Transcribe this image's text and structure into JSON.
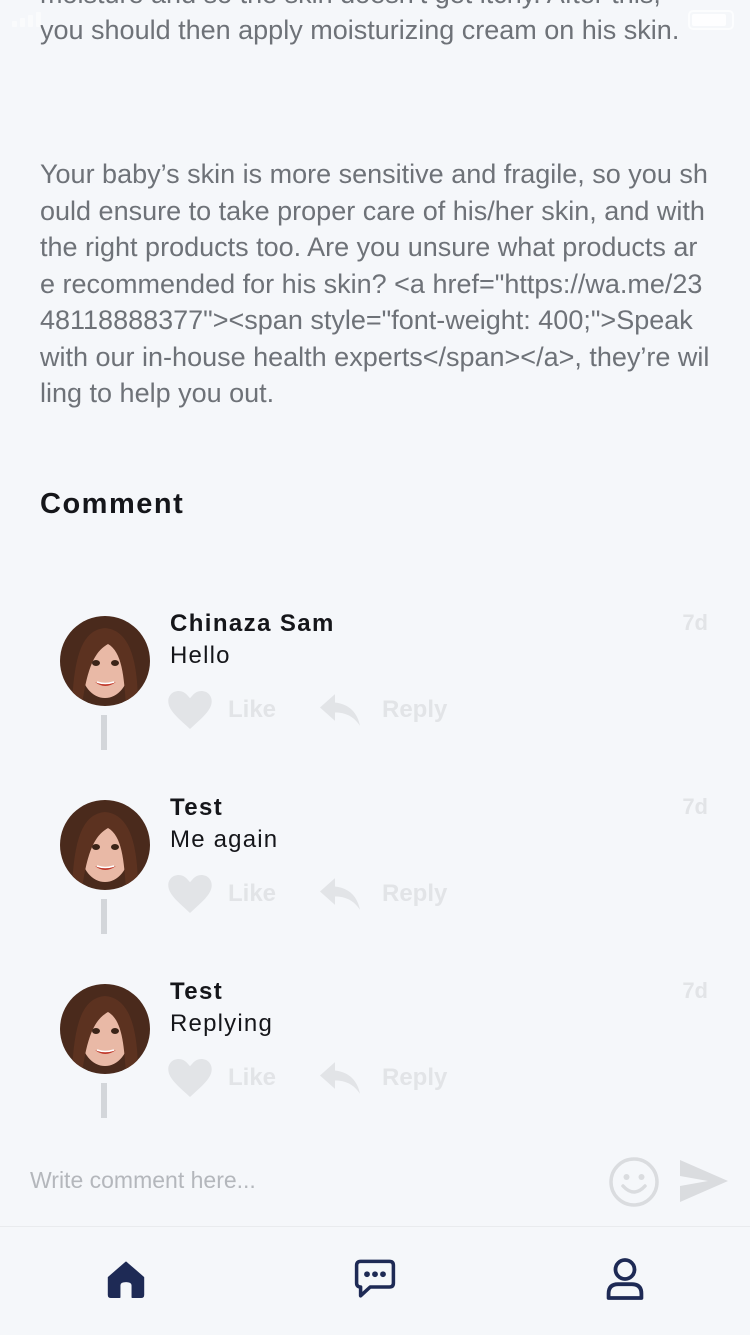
{
  "article": {
    "cut_text": "moisture and so the skin doesn’t get itchy. After this, you should then apply moisturizing cream on his skin.",
    "paragraph": "Your baby’s skin is more sensitive and fragile, so you should ensure to take proper care of his/her skin, and with the right products too. Are you unsure what products are recommended for his skin? <a href=\"https://wa.me/2348118888377\"><span style=\"font-weight: 400;\">Speak with our in-house health experts</span></a>, they’re willing to help you out."
  },
  "comments_section": {
    "heading": "Comment",
    "comments": [
      {
        "name": "Chinaza Sam",
        "text": "Hello",
        "time": "7d",
        "like_label": "Like",
        "reply_label": "Reply"
      },
      {
        "name": "Test",
        "text": "Me again",
        "time": "7d",
        "like_label": "Like",
        "reply_label": "Reply"
      },
      {
        "name": "Test",
        "text": "Replying",
        "time": "7d",
        "like_label": "Like",
        "reply_label": "Reply"
      }
    ]
  },
  "composer": {
    "placeholder": "Write comment here...",
    "emoji_icon": "smiley-icon",
    "send_icon": "send-icon"
  },
  "bottom_nav": {
    "items": [
      {
        "icon": "home-icon",
        "active": true
      },
      {
        "icon": "chat-icon",
        "active": false
      },
      {
        "icon": "profile-icon",
        "active": false
      }
    ]
  },
  "colors": {
    "background": "#f5f7fa",
    "body_text": "#6e7278",
    "heading": "#15161a",
    "muted": "#e2e4e7",
    "nav_icon": "#1e2a55"
  }
}
